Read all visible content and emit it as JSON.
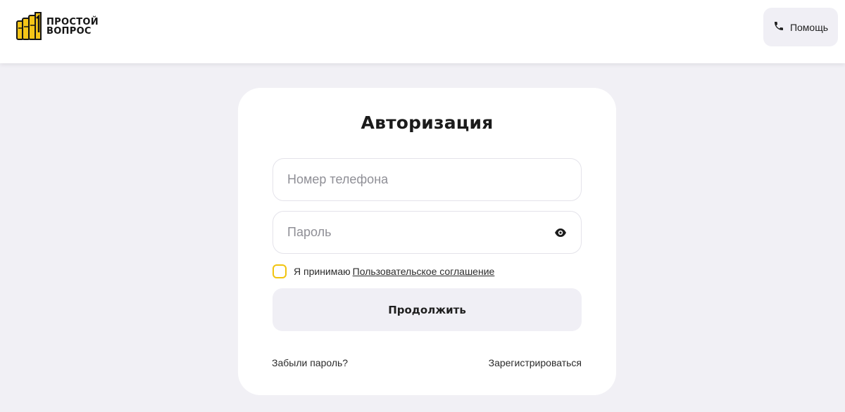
{
  "header": {
    "logo": {
      "line1": "ПРОСТОЙ",
      "line2": "ВОПРОС",
      "icon": "thumbs-up-logo-icon"
    },
    "help_button": {
      "label": "Помощь",
      "icon": "phone-icon"
    }
  },
  "login_form": {
    "title": "Авторизация",
    "phone_field": {
      "placeholder": "Номер телефона",
      "value": ""
    },
    "password_field": {
      "placeholder": "Пароль",
      "value": "",
      "toggle_icon": "eye-icon"
    },
    "agreement": {
      "checked": false,
      "text": "Я принимаю",
      "link_label": "Пользовательское соглашение"
    },
    "submit_label": "Продолжить",
    "forgot_password_label": "Забыли пароль?",
    "register_label": "Зарегистрироваться"
  },
  "colors": {
    "page_background": "#f1f0f5",
    "card_background": "#ffffff",
    "button_background": "#f0eff5",
    "checkbox_border": "#f1c40f",
    "logo_yellow": "#f5c518"
  }
}
